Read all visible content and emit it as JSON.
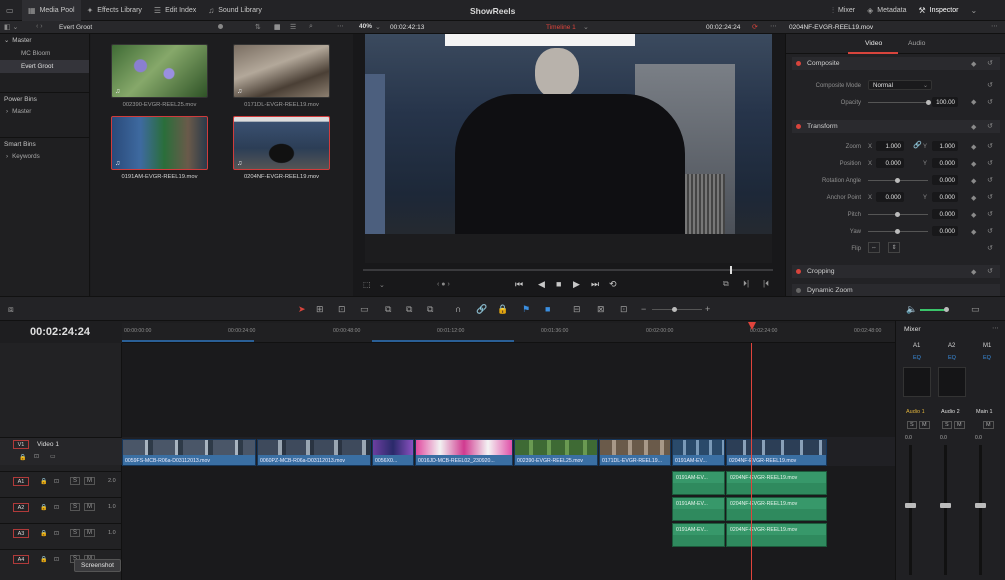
{
  "topbar": {
    "media_pool": "Media Pool",
    "effects_library": "Effects Library",
    "edit_index": "Edit Index",
    "sound_library": "Sound Library",
    "title": "ShowReels",
    "mixer": "Mixer",
    "metadata": "Metadata",
    "inspector": "Inspector"
  },
  "bins": {
    "current": "Evert Groot",
    "master_label": "Master",
    "items": [
      "MC Bloom",
      "Evert Groot"
    ],
    "power_bins_label": "Power Bins",
    "power_bins_items": [
      "Master"
    ],
    "smart_bins_label": "Smart Bins",
    "smart_bins_items": [
      "Keywords"
    ]
  },
  "media": {
    "clips": [
      {
        "name": "002390-EVGR-REEL25.mov",
        "selected": false
      },
      {
        "name": "0171DL-EVGR-REEL19.mov",
        "selected": false
      },
      {
        "name": "0191AM-EVGR-REEL19.mov",
        "selected": true
      },
      {
        "name": "0204NF-EVGR-REEL19.mov",
        "selected": true
      }
    ]
  },
  "viewer": {
    "zoom": "40%",
    "source_timecode": "00:02:42:13",
    "timeline_name": "Timeline 1",
    "record_timecode": "00:02:24:24"
  },
  "inspector": {
    "clip_name": "0204NF-EVGR-REEL19.mov",
    "tab_video": "Video",
    "tab_audio": "Audio",
    "composite_title": "Composite",
    "composite_mode_label": "Composite Mode",
    "composite_mode_value": "Normal",
    "opacity_label": "Opacity",
    "opacity_value": "100.00",
    "transform_title": "Transform",
    "zoom_label": "Zoom",
    "zoom_x": "1.000",
    "zoom_y": "1.000",
    "position_label": "Position",
    "position_x": "0.000",
    "position_y": "0.000",
    "rotation_label": "Rotation Angle",
    "rotation_value": "0.000",
    "anchor_label": "Anchor Point",
    "anchor_x": "0.000",
    "anchor_y": "0.000",
    "pitch_label": "Pitch",
    "pitch_value": "0.000",
    "yaw_label": "Yaw",
    "yaw_value": "0.000",
    "flip_label": "Flip",
    "x_axis": "X",
    "y_axis": "Y",
    "cropping_title": "Cropping",
    "dynamic_zoom_title": "Dynamic Zoom"
  },
  "timeline": {
    "timecode": "00:02:24:24",
    "ruler_labels": [
      "00:00:00:00",
      "00:00:24:00",
      "00:00:48:00",
      "00:01:12:00",
      "00:01:36:00",
      "00:02:00:00",
      "00:02:24:00",
      "00:02:48:00"
    ],
    "video_track": {
      "id": "V1",
      "name": "Video 1"
    },
    "audio_tracks": [
      {
        "id": "A1",
        "level": "2.0"
      },
      {
        "id": "A2",
        "level": "1.0"
      },
      {
        "id": "A3",
        "level": "1.0"
      },
      {
        "id": "A4",
        "level": ""
      }
    ],
    "video_clips": [
      "0059FS-MCB-R06a-D03112013.mov",
      "0060PZ-MCB-R06a-D03112013.mov",
      "0056X0...",
      "0016JD-MCB-REEL02_230920...",
      "002390-EVGR-REEL25.mov",
      "0171DL-EVGR-REEL19...",
      "0191AM-EV...",
      "0204NF-EVGR-REEL19.mov"
    ],
    "audio_clips": [
      "0191AM-EV...",
      "0204NF-EVGR-REEL19.mov"
    ]
  },
  "mixer": {
    "title": "Mixer",
    "channels": [
      {
        "bus": "A1",
        "name": "Audio 1",
        "level": "0.0"
      },
      {
        "bus": "A2",
        "name": "Audio 2",
        "level": "0.0"
      },
      {
        "bus": "M1",
        "name": "Main 1",
        "level": "0.0"
      }
    ],
    "eq_label": "EQ",
    "solo": "S",
    "mute": "M"
  },
  "tooltip": "Screenshot",
  "colors": {
    "accent_red": "#d8443c",
    "video_clip": "#3a6fa3",
    "audio_clip": "#37986a",
    "playhead": "#e0443c"
  }
}
